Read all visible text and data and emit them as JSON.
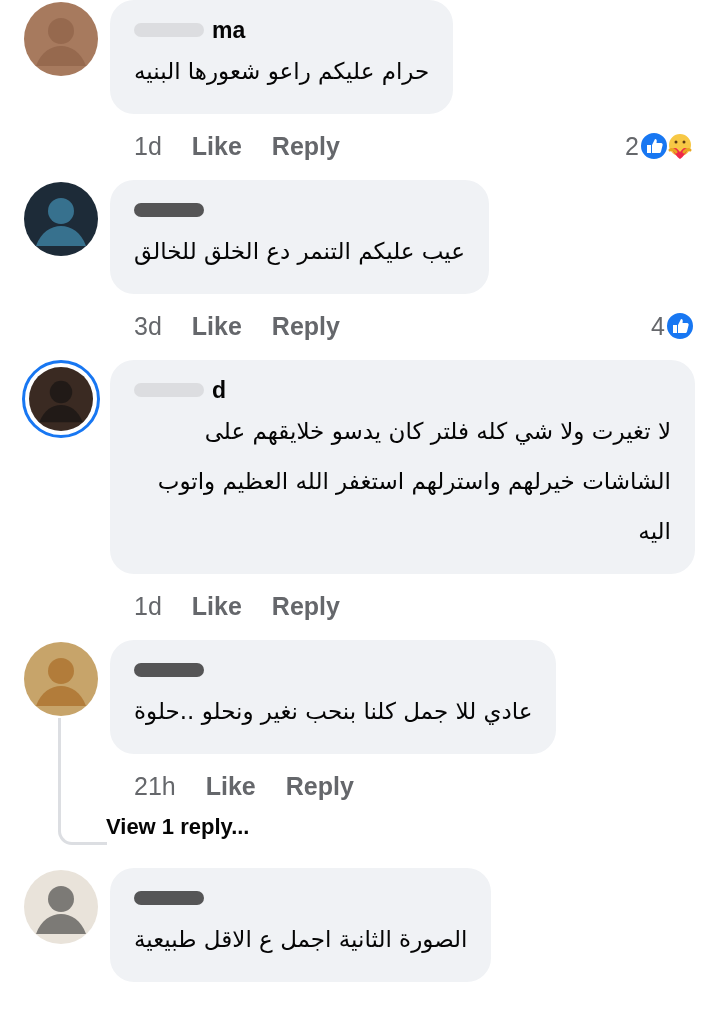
{
  "comments": [
    {
      "name": "ma",
      "text": "حرام عليكم راعو شعورها البنيه",
      "has_story": false,
      "time": "1d",
      "like": "Like",
      "reply": "Reply",
      "reaction_count": "2",
      "reactions": [
        {
          "kind": "like"
        },
        {
          "kind": "care"
        }
      ]
    },
    {
      "text": "عيب عليكم التنمر  دع الخلق للخالق",
      "has_story": false,
      "time": "3d",
      "like": "Like",
      "reply": "Reply",
      "reaction_count": "4",
      "reactions": [
        {
          "kind": "like"
        }
      ]
    },
    {
      "name": "d",
      "text": "لا تغيرت ولا شي  كله فلتر  كان يدسو خلايقهم على الشاشات خيرلهم  واسترلهم استغفر الله العظيم واتوب اليه",
      "has_story": true,
      "time": "1d",
      "like": "Like",
      "reply": "Reply"
    },
    {
      "text": "عادي للا جمل كلنا بنحب نغير ونحلو ..حلوة",
      "has_story": false,
      "time": "21h",
      "like": "Like",
      "reply": "Reply",
      "replies_link": "View 1 reply..."
    },
    {
      "text": "الصورة الثانية اجمل ع الاقل طبيعية",
      "has_story": false
    }
  ]
}
